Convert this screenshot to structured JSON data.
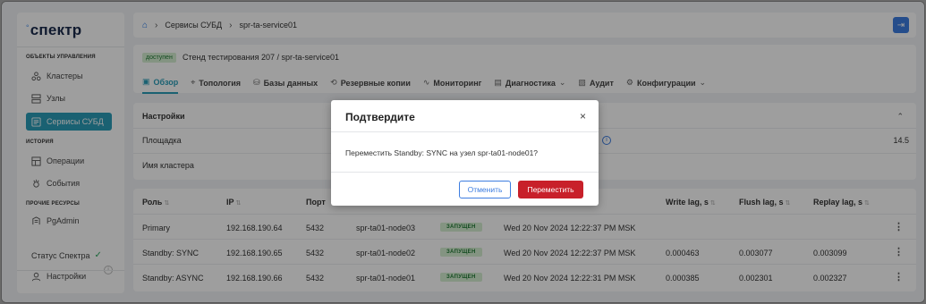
{
  "app": {
    "logo_text": "спектр"
  },
  "sidebar": {
    "section_management": "ОБЪЕКТЫ УПРАВЛЕНИЯ",
    "section_history": "ИСТОРИЯ",
    "section_other": "ПРОЧИЕ РЕСУРСЫ",
    "items": [
      {
        "label": "Кластеры",
        "icon": "cluster-icon"
      },
      {
        "label": "Узлы",
        "icon": "server-icon"
      },
      {
        "label": "Сервисы СУБД",
        "icon": "database-service-icon",
        "active": true
      },
      {
        "label": "Операции",
        "icon": "operations-icon"
      },
      {
        "label": "События",
        "icon": "events-icon"
      },
      {
        "label": "PgAdmin",
        "icon": "pgadmin-icon"
      }
    ],
    "status_label": "Статус Спектра",
    "settings_label": "Настройки"
  },
  "breadcrumb": {
    "items": [
      "Сервисы СУБД",
      "spr-ta-service01"
    ]
  },
  "header": {
    "badge": "доступен",
    "title": "Стенд тестирования 207 / spr-ta-service01",
    "tabs": [
      {
        "label": "Обзор",
        "icon": "info-icon",
        "active": true
      },
      {
        "label": "Топология",
        "icon": "topology-icon"
      },
      {
        "label": "Базы данных",
        "icon": "database-icon"
      },
      {
        "label": "Резервные копии",
        "icon": "backup-icon"
      },
      {
        "label": "Мониторинг",
        "icon": "chart-icon"
      },
      {
        "label": "Диагностика",
        "icon": "diagnostics-icon",
        "dropdown": true
      },
      {
        "label": "Аудит",
        "icon": "audit-icon"
      },
      {
        "label": "Конфигурации",
        "icon": "gear-icon",
        "dropdown": true
      }
    ]
  },
  "settings": {
    "title": "Настройки",
    "site_label": "Площадка",
    "site_value_right": "14.5",
    "cluster_name_label": "Имя кластера"
  },
  "table": {
    "columns": [
      "Роль",
      "IP",
      "Порт",
      "Write lag, s",
      "Flush lag, s",
      "Replay lag, s"
    ],
    "rows": [
      {
        "role": "Primary",
        "ip": "192.168.190.64",
        "port": "5432",
        "node": "spr-ta01-node03",
        "status": "ЗАПУЩЕН",
        "time": "Wed 20 Nov 2024 12:22:37 PM MSK",
        "write": "",
        "flush": "",
        "replay": ""
      },
      {
        "role": "Standby: SYNC",
        "ip": "192.168.190.65",
        "port": "5432",
        "node": "spr-ta01-node02",
        "status": "ЗАПУЩЕН",
        "time": "Wed 20 Nov 2024 12:22:37 PM MSK",
        "write": "0.000463",
        "flush": "0.003077",
        "replay": "0.003099"
      },
      {
        "role": "Standby: ASYNC",
        "ip": "192.168.190.66",
        "port": "5432",
        "node": "spr-ta01-node01",
        "status": "ЗАПУЩЕН",
        "time": "Wed 20 Nov 2024 12:22:31 PM MSK",
        "write": "0.000385",
        "flush": "0.002301",
        "replay": "0.002327"
      }
    ]
  },
  "modal": {
    "title": "Подтвердите",
    "message": "Переместить Standby: SYNC на узел spr-ta01-node01?",
    "cancel_label": "Отменить",
    "confirm_label": "Переместить"
  }
}
